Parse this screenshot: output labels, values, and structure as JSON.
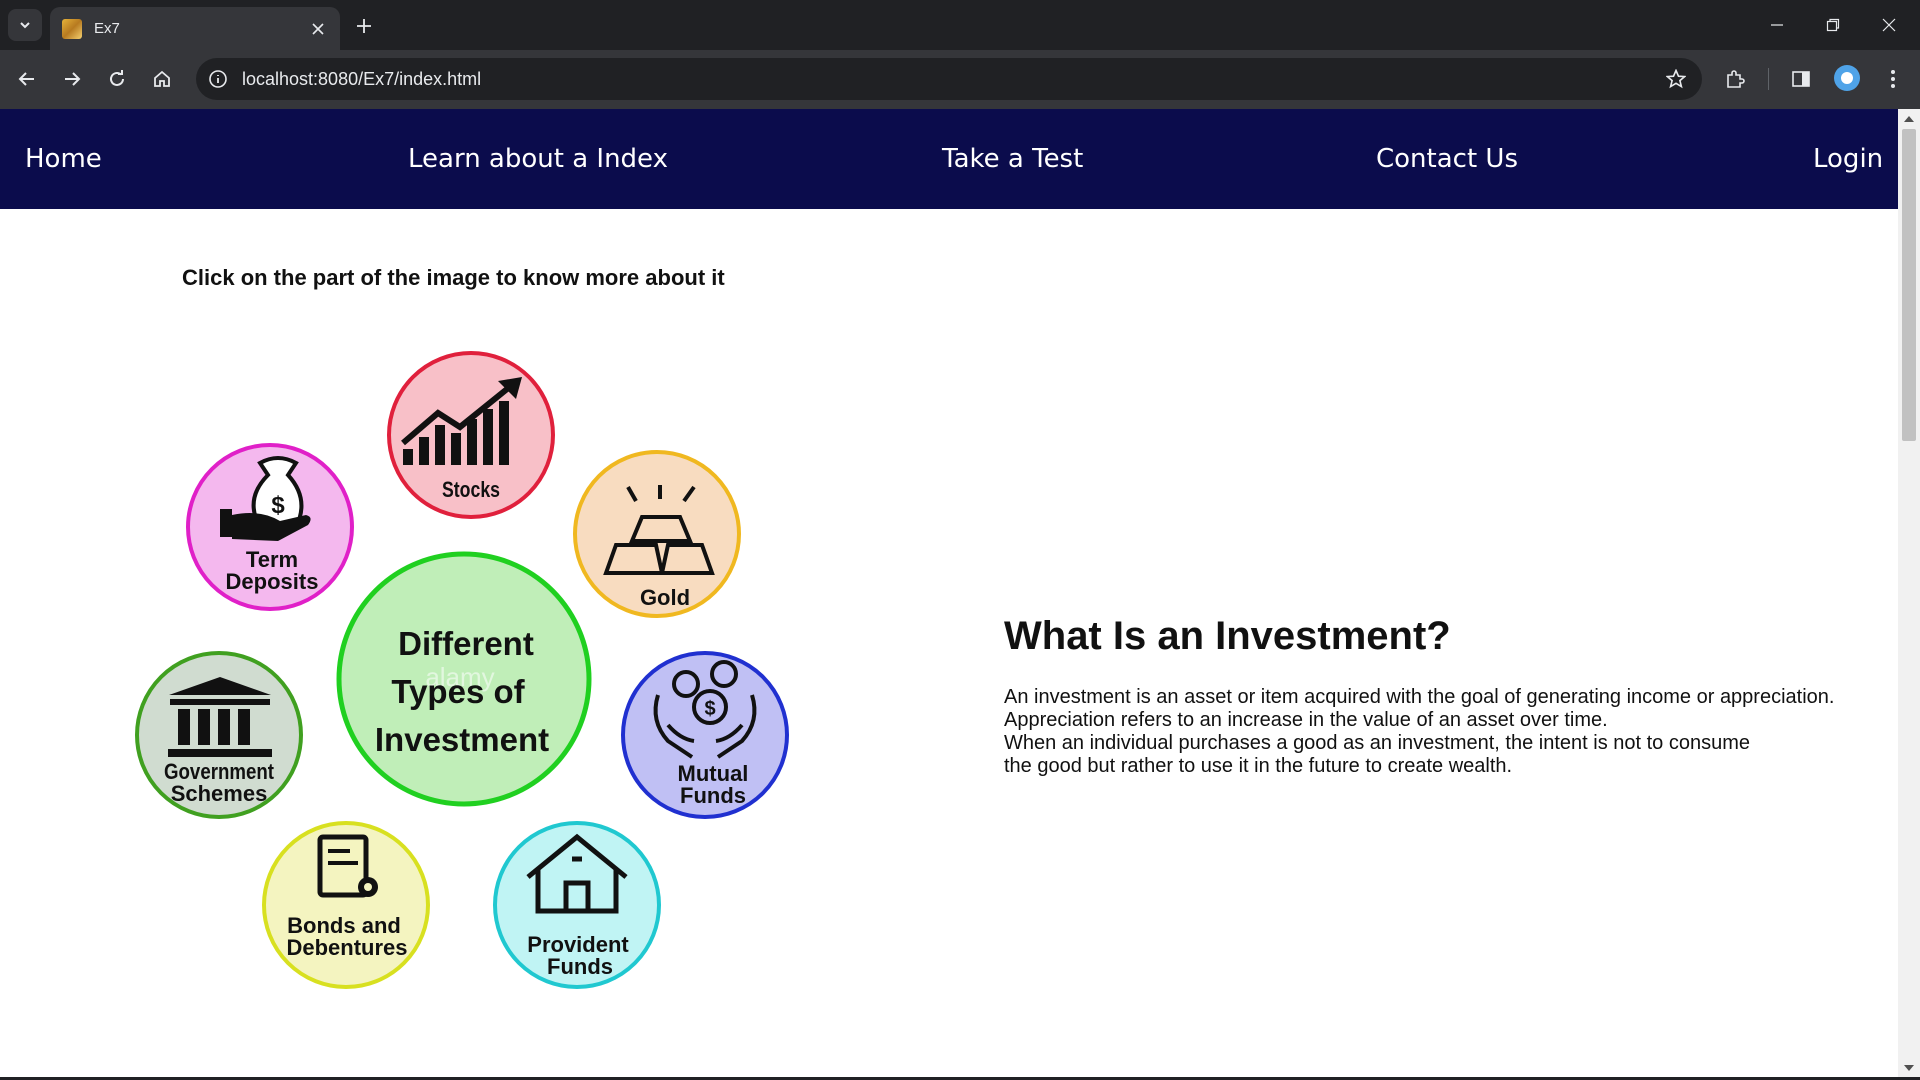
{
  "browser": {
    "tab_title": "Ex7",
    "url": "localhost:8080/Ex7/index.html"
  },
  "nav": {
    "items": [
      "Home",
      "Learn about a Index",
      "Take a Test",
      "Contact Us",
      "Login"
    ]
  },
  "instruction": "Click on the part of the image to know more about it",
  "infographic": {
    "center_line1": "Different",
    "center_line2": "Types of",
    "center_line3": "Investment",
    "watermark": "alamy",
    "stocks": "Stocks",
    "term_line1": "Term",
    "term_line2": "Deposits",
    "gold": "Gold",
    "gov_line1": "Government",
    "gov_line2": "Schemes",
    "mutual_line1": "Mutual",
    "mutual_line2": "Funds",
    "bonds_line1": "Bonds and",
    "bonds_line2": "Debentures",
    "provident_line1": "Provident",
    "provident_line2": "Funds",
    "colors": {
      "stocks": "#f8c0c8",
      "term": "#f4b8ee",
      "gold": "#f8dcc0",
      "center": "#c0eeb8",
      "gov": "#d0dcd0",
      "mutual": "#c0c0f4",
      "bonds": "#f4f4c0",
      "provident": "#c0f4f4"
    }
  },
  "article": {
    "title": "What Is an Investment?",
    "lines": [
      "An investment is an asset or item acquired with the goal of generating income or appreciation.",
      "Appreciation refers to an increase in the value of an asset over time.",
      "When an individual purchases a good as an investment, the intent is not to consume",
      "the good but rather to use it in the future to create wealth."
    ]
  }
}
